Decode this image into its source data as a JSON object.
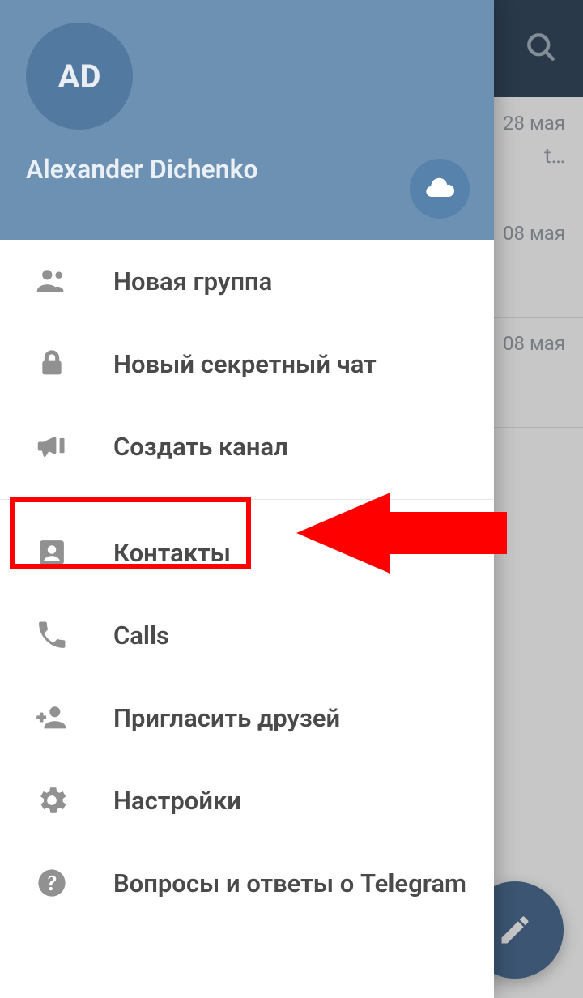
{
  "account": {
    "avatar_initials": "AD",
    "name": "Alexander Dichenko"
  },
  "menu": {
    "new_group": "Новая группа",
    "secret_chat": "Новый секретный чат",
    "create_channel": "Создать канал",
    "contacts": "Контакты",
    "calls": "Calls",
    "invite": "Пригласить друзей",
    "settings": "Настройки",
    "faq": "Вопросы и ответы о Telegram"
  },
  "chats": [
    {
      "date": "28 мая",
      "snippet": "t…"
    },
    {
      "date": "08 мая",
      "snippet": ""
    },
    {
      "date": "08 мая",
      "snippet": ""
    }
  ],
  "icons": {
    "search": "search-icon",
    "cloud": "cloud-icon",
    "fab": "pencil-icon"
  },
  "annotation": {
    "highlight_target": "contacts",
    "arrow_color": "#ff0000"
  }
}
